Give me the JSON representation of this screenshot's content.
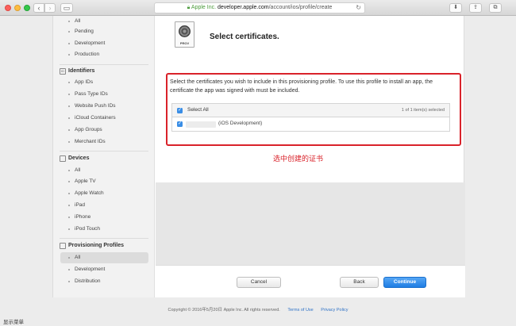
{
  "browser": {
    "url_company": "Apple Inc.",
    "url_host": "developer.apple.com",
    "url_path": "/account/ios/profile/create",
    "lock_icon": "lock-icon",
    "back_icon": "chevron-left-icon",
    "forward_icon": "chevron-right-icon"
  },
  "sidebar": {
    "certificates_items": [
      "All",
      "Pending",
      "Development",
      "Production"
    ],
    "identifiers_heading": "Identifiers",
    "identifiers_items": [
      "App IDs",
      "Pass Type IDs",
      "Website Push IDs",
      "iCloud Containers",
      "App Groups",
      "Merchant IDs"
    ],
    "devices_heading": "Devices",
    "devices_items": [
      "All",
      "Apple TV",
      "Apple Watch",
      "iPad",
      "iPhone",
      "iPod Touch"
    ],
    "profiles_heading": "Provisioning Profiles",
    "profiles_items": [
      "All",
      "Development",
      "Distribution"
    ],
    "active_item": "Provisioning Profiles / All"
  },
  "main": {
    "icon_label": "PROV",
    "title": "Select certificates.",
    "intro": "Select the certificates you wish to include in this provisioning profile. To use this profile to install an app, the certificate the app was signed with must be included.",
    "table": {
      "select_all": "Select All",
      "count": "1  of 1 item(s) selected",
      "rows": [
        {
          "name": "(iOS Development)",
          "checked": true
        }
      ]
    },
    "annotation": "选中创建的证书",
    "buttons": {
      "cancel": "Cancel",
      "back": "Back",
      "continue": "Continue"
    }
  },
  "footer": {
    "copyright": "Copyright © 2016年5月20日 Apple Inc. All rights reserved.",
    "terms": "Terms of Use",
    "privacy": "Privacy Policy"
  },
  "status_bar": "显示菜单",
  "colors": {
    "accent": "#1f7de3",
    "annotation_red": "#d9222a",
    "checkbox": "#3a8ee6"
  }
}
